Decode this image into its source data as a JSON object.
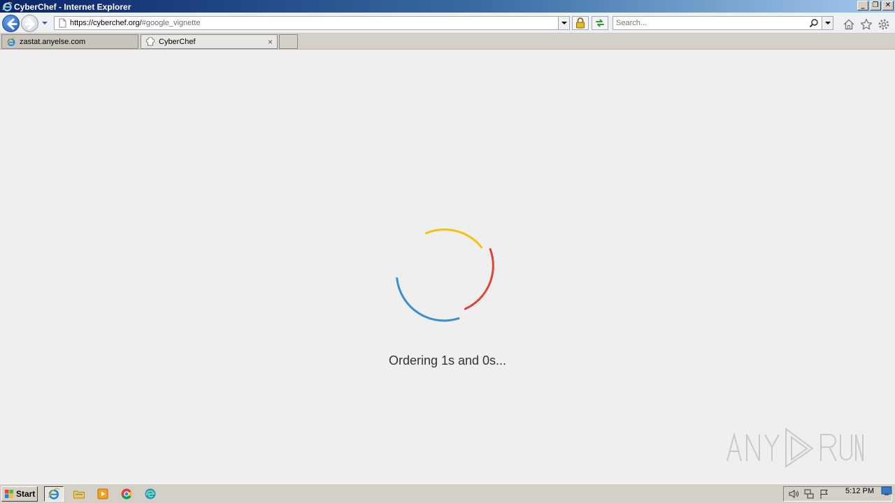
{
  "window": {
    "title": "CyberChef - Internet Explorer",
    "controls": {
      "minimize": "_",
      "restore": "❐",
      "close": "✕"
    }
  },
  "navbar": {
    "url_host": "https://cyberchef.org/",
    "url_hash": "#google_vignette",
    "search_placeholder": "Search..."
  },
  "tabs": [
    {
      "label": "zastat.anyelse.com",
      "active": false
    },
    {
      "label": "CyberChef",
      "active": true,
      "close": "×"
    }
  ],
  "content": {
    "loading_text": "Ordering 1s and 0s...",
    "spinner_colors": {
      "yellow": "#f4c20d",
      "red": "#db4437",
      "blue": "#3b8fd0"
    }
  },
  "watermark": {
    "text": "ANY RUN"
  },
  "taskbar": {
    "start_label": "Start",
    "apps": [
      "internet-explorer",
      "file-explorer",
      "media-player",
      "chrome",
      "edge"
    ],
    "clock": "5:12 PM"
  }
}
